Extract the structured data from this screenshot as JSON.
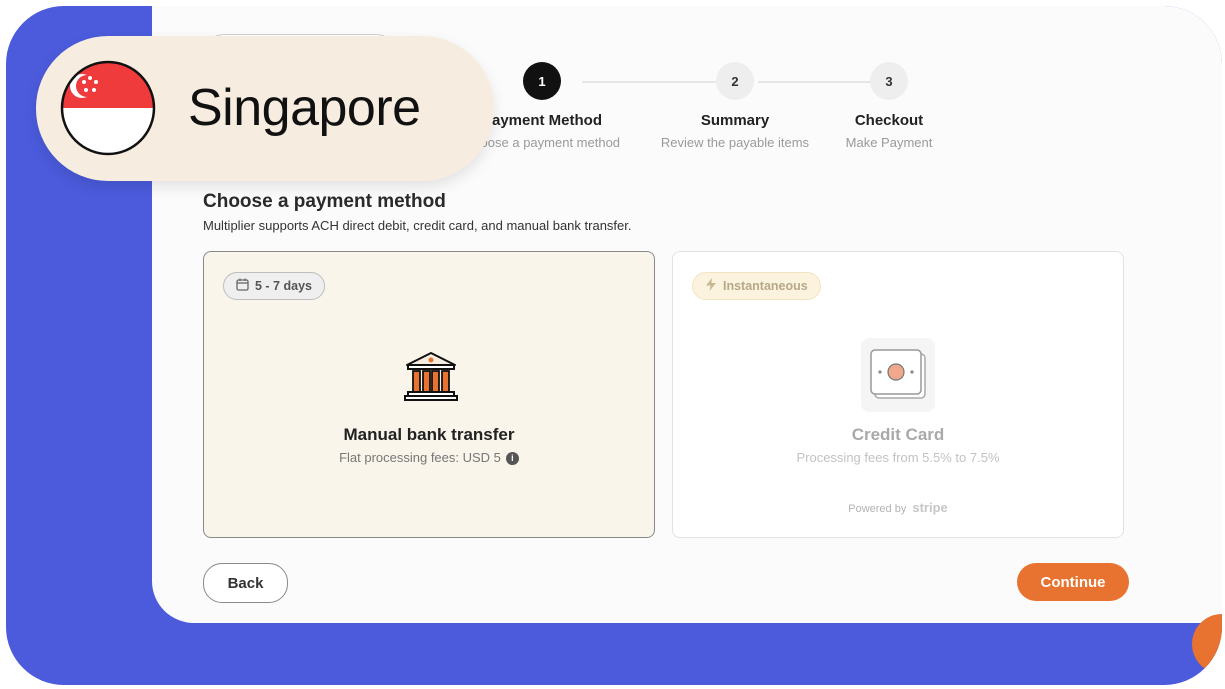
{
  "country_badge": {
    "name": "Singapore",
    "flag_icon": "singapore-flag-icon"
  },
  "stepper": {
    "steps": [
      {
        "number": "1",
        "title": "Payment Method",
        "subtitle": "Choose a payment method",
        "state": "active"
      },
      {
        "number": "2",
        "title": "Summary",
        "subtitle": "Review the payable items",
        "state": "inactive"
      },
      {
        "number": "3",
        "title": "Checkout",
        "subtitle": "Make Payment",
        "state": "inactive"
      }
    ]
  },
  "section": {
    "title": "Choose a payment method",
    "subtitle": "Multiplier supports ACH direct debit, credit card, and manual bank transfer."
  },
  "options": {
    "bank": {
      "badge": "5 - 7 days",
      "badge_icon": "calendar-icon",
      "icon": "bank-icon",
      "title": "Manual bank transfer",
      "fees": "Flat processing fees: USD 5",
      "info_icon": "info-icon",
      "selected": true
    },
    "credit_card": {
      "badge": "Instantaneous",
      "badge_icon": "lightning-icon",
      "icon": "credit-card-icon",
      "title": "Credit Card",
      "fees": "Processing fees from 5.5% to 7.5%",
      "powered_by": "Powered by",
      "provider": "stripe",
      "selected": false
    }
  },
  "actions": {
    "back": "Back",
    "continue": "Continue"
  },
  "colors": {
    "frame": "#4b5bdc",
    "accent": "#e8722f",
    "selected_card_bg": "#f9f5ea",
    "pill_bg": "#f6ede0"
  }
}
